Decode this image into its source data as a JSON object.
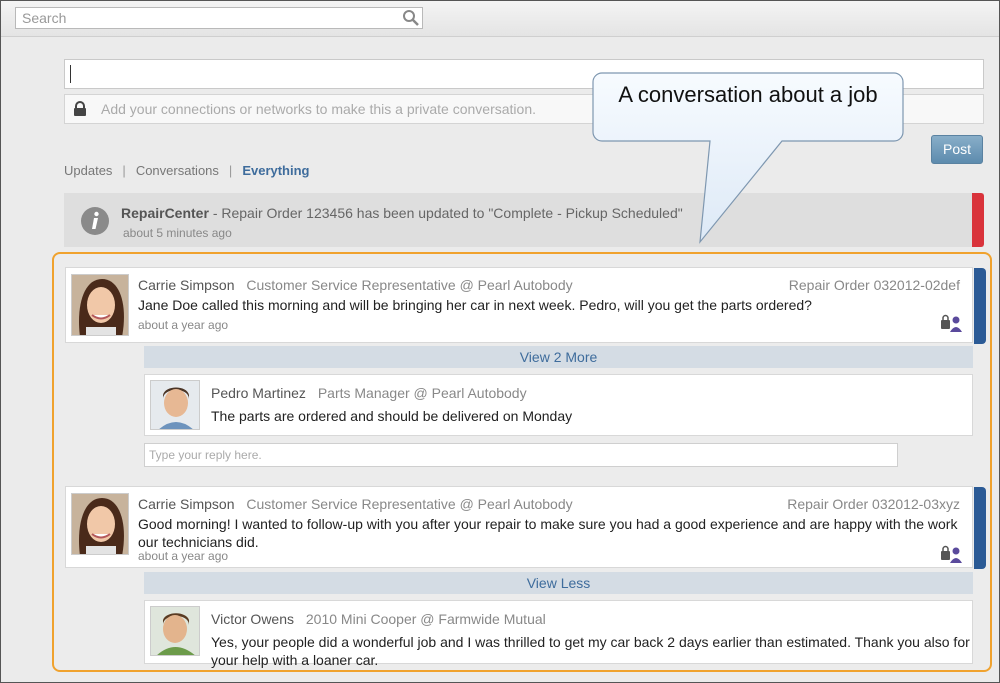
{
  "search": {
    "placeholder": "Search"
  },
  "compose": {
    "private_placeholder": "Add your connections or networks to make this a private conversation."
  },
  "post_button": "Post",
  "filters": {
    "updates": "Updates",
    "conversations": "Conversations",
    "everything": "Everything",
    "separator": "|"
  },
  "notice": {
    "source": "RepairCenter",
    "message": "- Repair Order 123456 has been updated to \"Complete - Pickup Scheduled\"",
    "time": "about 5 minutes ago"
  },
  "callout": {
    "text": "A conversation about a job"
  },
  "conversations": [
    {
      "author": "Carrie Simpson",
      "role": "Customer Service Representative @ Pearl Autobody",
      "reference": "Repair Order 032012-02def",
      "body": "Jane Doe called this morning and will be bringing her car in next week. Pedro, will you get the parts ordered?",
      "time": "about a year ago",
      "toggle": "View 2 More",
      "reply": {
        "author": "Pedro Martinez",
        "role": "Parts Manager @ Pearl Autobody",
        "body": "The parts are ordered and should be delivered on Monday"
      },
      "reply_placeholder": "Type your reply here."
    },
    {
      "author": "Carrie Simpson",
      "role": "Customer Service Representative @ Pearl Autobody",
      "reference": "Repair Order 032012-03xyz",
      "body": "Good morning! I wanted to follow-up with you after your repair to make sure you had a good experience and are happy with the work our technicians did.",
      "time": "about a year ago",
      "toggle": "View Less",
      "reply": {
        "author": "Victor Owens",
        "role": "2010 Mini Cooper @ Farmwide Mutual",
        "body": "Yes, your people did a wonderful job and I was thrilled to get my car back 2 days earlier than estimated. Thank you also for your  help with a loaner car."
      }
    }
  ],
  "colors": {
    "accent": "#3e6c9c",
    "highlight": "#f0a22e",
    "alert": "#d9333b",
    "thread_bar": "#2b5a95"
  }
}
